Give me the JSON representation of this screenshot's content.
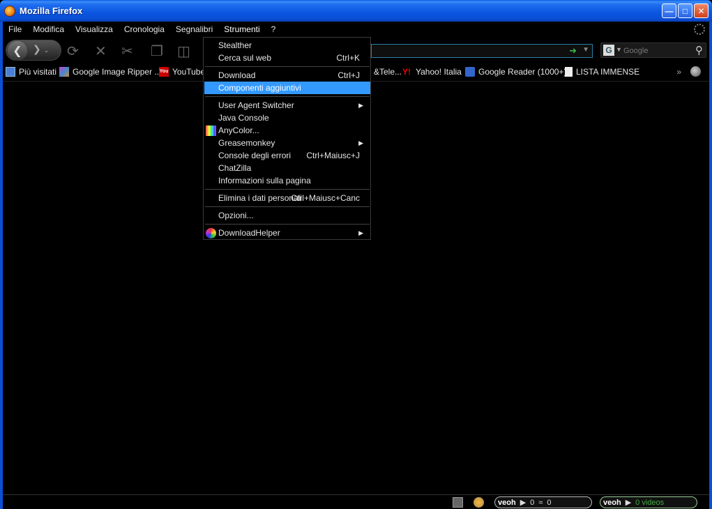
{
  "window": {
    "title": "Mozilla Firefox"
  },
  "menubar": {
    "items": [
      "File",
      "Modifica",
      "Visualizza",
      "Cronologia",
      "Segnalibri",
      "Strumenti",
      "?"
    ]
  },
  "search": {
    "placeholder": "Google"
  },
  "bookmarks": [
    {
      "label": "Più visitati",
      "icon": "most-visited-icon"
    },
    {
      "label": "Google Image Ripper ...",
      "icon": "image-ripper-icon"
    },
    {
      "label": "YouTube",
      "icon": "youtube-icon"
    },
    {
      "label": "&Tele...",
      "icon": "none"
    },
    {
      "label": "Yahoo! Italia",
      "icon": "yahoo-icon"
    },
    {
      "label": "Google Reader (1000+)",
      "icon": "rss-icon"
    },
    {
      "label": "LISTA IMMENSE",
      "icon": "page-icon"
    }
  ],
  "tools_menu": {
    "items": [
      {
        "label": "Stealther",
        "shortcut": ""
      },
      {
        "label": "Cerca sul web",
        "shortcut": "Ctrl+K"
      },
      {
        "label": "Download",
        "shortcut": "Ctrl+J"
      },
      {
        "label": "Componenti aggiuntivi",
        "shortcut": ""
      },
      {
        "label": "User Agent Switcher",
        "shortcut": ""
      },
      {
        "label": "Java Console",
        "shortcut": ""
      },
      {
        "label": "AnyColor...",
        "shortcut": ""
      },
      {
        "label": "Greasemonkey",
        "shortcut": ""
      },
      {
        "label": "Console degli errori",
        "shortcut": "Ctrl+Maiusc+J"
      },
      {
        "label": "ChatZilla",
        "shortcut": ""
      },
      {
        "label": "Informazioni sulla pagina",
        "shortcut": ""
      },
      {
        "label": "Elimina i dati personali",
        "shortcut": "Ctrl+Maiusc+Canc"
      },
      {
        "label": "Opzioni...",
        "shortcut": ""
      },
      {
        "label": "DownloadHelper",
        "shortcut": ""
      }
    ]
  },
  "statusbar": {
    "veoh1": {
      "logo": "veoh",
      "count_a": "0",
      "count_b": "0"
    },
    "veoh2": {
      "logo": "veoh",
      "label": "0 videos"
    }
  },
  "colors": {
    "highlight": "#3399ff",
    "titlebar": "#0a55e0",
    "background": "#000000"
  }
}
